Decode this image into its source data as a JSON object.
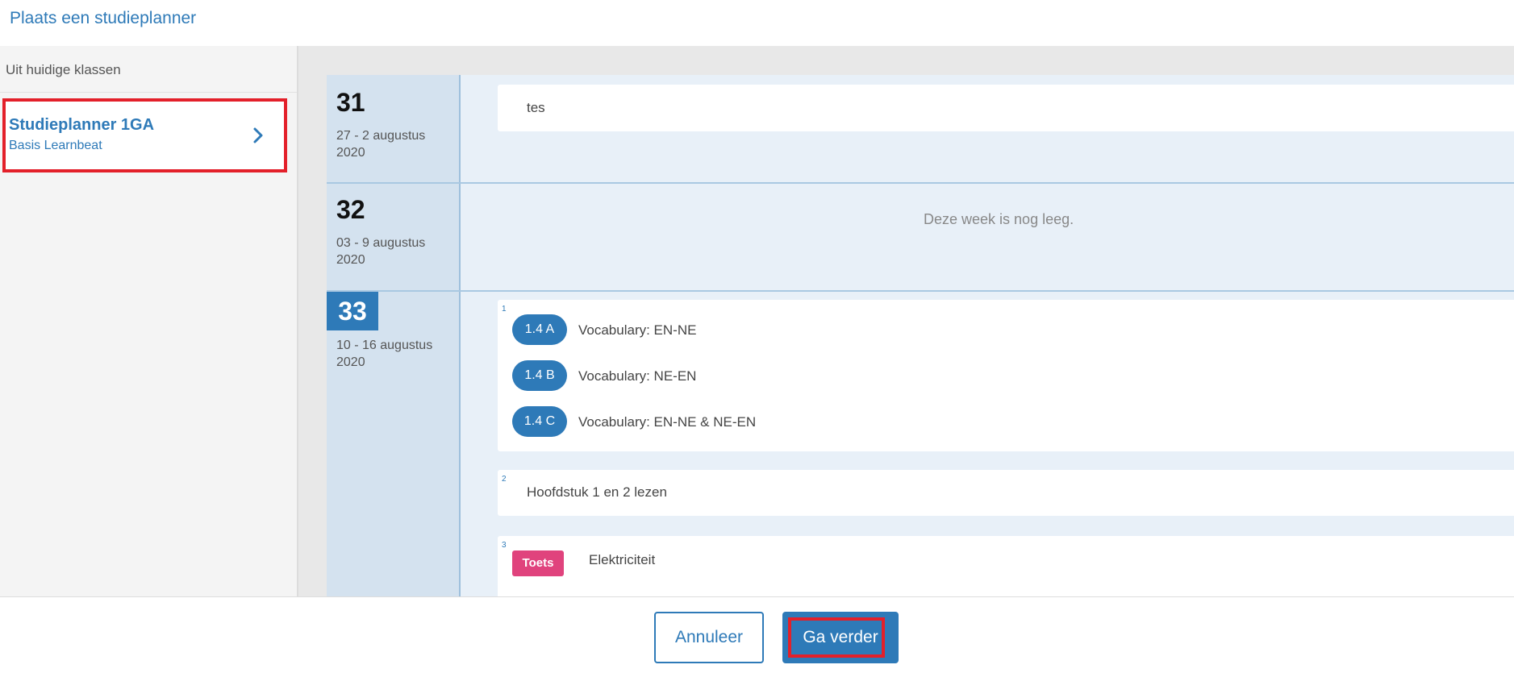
{
  "header": {
    "title": "Plaats een studieplanner"
  },
  "sidebar": {
    "heading": "Uit huidige klassen",
    "items": [
      {
        "title": "Studieplanner 1GA",
        "subtitle": "Basis Learnbeat"
      }
    ]
  },
  "weeks": [
    {
      "number": "31",
      "date_range": "27 - 2 augustus 2020",
      "items": [
        {
          "text": "tes"
        }
      ]
    },
    {
      "number": "32",
      "date_range": "03 - 9 augustus 2020",
      "empty_message": "Deze week is nog leeg."
    },
    {
      "number": "33",
      "date_range": "10 - 16 augustus 2020",
      "items": [
        {
          "index": "1",
          "lessons": [
            {
              "tag": "1.4 A",
              "label": "Vocabulary: EN-NE"
            },
            {
              "tag": "1.4 B",
              "label": "Vocabulary: NE-EN"
            },
            {
              "tag": "1.4 C",
              "label": "Vocabulary: EN-NE & NE-EN"
            }
          ]
        },
        {
          "index": "2",
          "text": "Hoofdstuk 1 en 2 lezen"
        },
        {
          "index": "3",
          "badge": "Toets",
          "text": "Elektriciteit"
        }
      ]
    }
  ],
  "footer": {
    "cancel_label": "Annuleer",
    "next_label": "Ga verder"
  },
  "colors": {
    "accent": "#2e7ab8",
    "toets_badge": "#e0437d",
    "highlight": "#e3202a"
  }
}
